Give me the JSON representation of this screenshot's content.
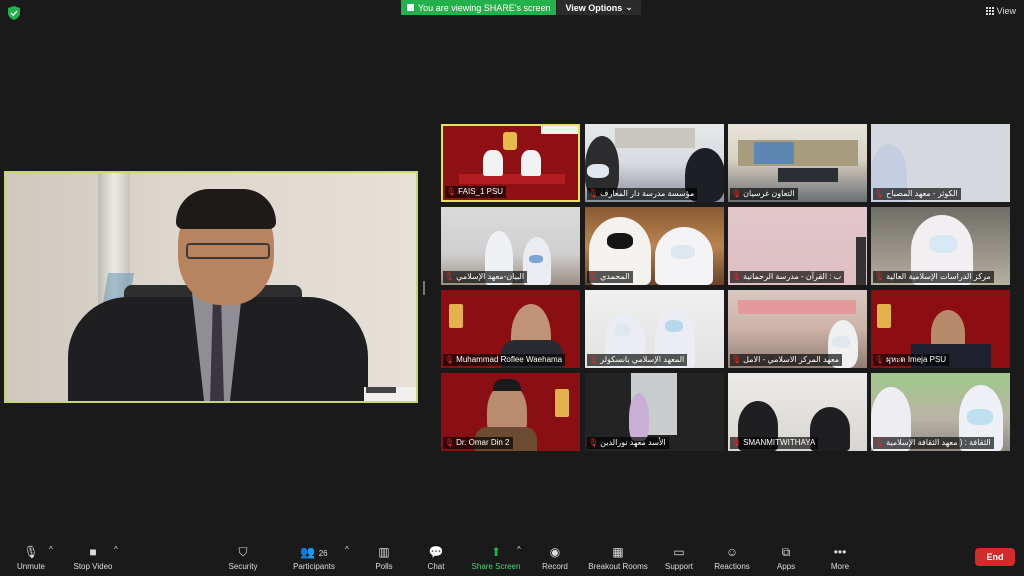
{
  "top": {
    "security_status_icon": "shield-check-icon",
    "share_banner_text": "You are viewing SHARE's screen",
    "view_options_label": "View Options",
    "view_label": "View"
  },
  "speaker": {
    "name": ""
  },
  "participants": [
    {
      "name": "FAIS_1 PSU",
      "active": true
    },
    {
      "name": "مؤسسة مدرسة دار المعارف"
    },
    {
      "name": "التعاون غرسيان"
    },
    {
      "name": "الكوثر - معهد المصباح"
    },
    {
      "name": "البيان-معهد الإسلامي"
    },
    {
      "name": "المحمدي"
    },
    {
      "name": "ب : القرآن - مدرسة الرحمانية"
    },
    {
      "name": "مركز الدراسات الإسلامية العالية"
    },
    {
      "name": "Muhammad Roflee Waehama"
    },
    {
      "name": "المعهد الإسلامي بانسكولر"
    },
    {
      "name": "معهد المركز الاسلامي - الامل"
    },
    {
      "name": "ผุหะด Imeja PSU"
    },
    {
      "name": "Dr. Omar Din 2"
    },
    {
      "name": "الأسد معهد نورالدين"
    },
    {
      "name": "SMANMITWITHAYA"
    },
    {
      "name": "الثقافة : ( معهد الثقافة الإسلامية"
    }
  ],
  "toolbar": {
    "unmute": "Unmute",
    "stop_video": "Stop Video",
    "security": "Security",
    "participants": "Participants",
    "participants_count": "26",
    "polls": "Polls",
    "chat": "Chat",
    "share_screen": "Share Screen",
    "record": "Record",
    "breakout_rooms": "Breakout Rooms",
    "support": "Support",
    "reactions": "Reactions",
    "apps": "Apps",
    "more": "More",
    "end": "End"
  },
  "colors": {
    "share_green": "#22b14c",
    "end_red": "#d22b2b",
    "active_border": "#e8e05a",
    "speaker_border": "#c8d66d"
  }
}
